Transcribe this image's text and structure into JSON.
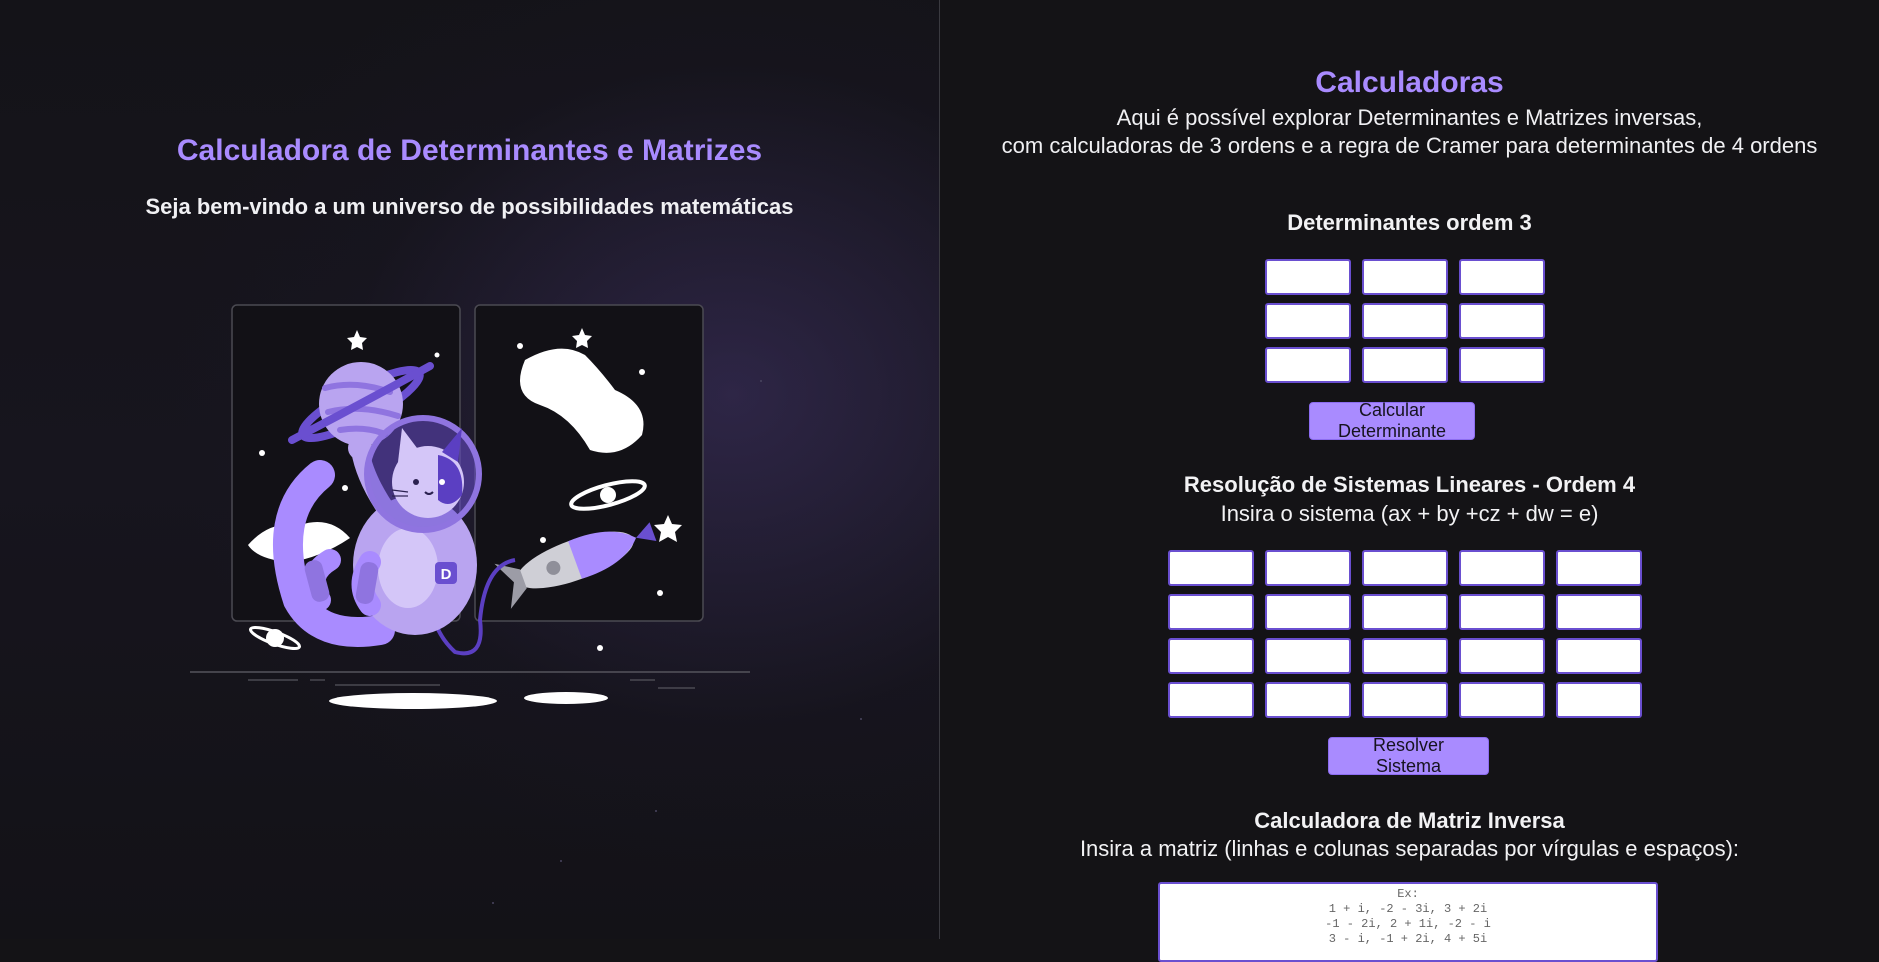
{
  "hero": {
    "title": "Calculadora de Determinantes e Matrizes",
    "subtitle": "Seja bem-vindo a um universo de possibilidades matemáticas",
    "illustration": "astronaut-cat-in-space-illustration"
  },
  "calculators": {
    "title": "Calculadoras",
    "description_line1": "Aqui é possível explorar Determinantes e Matrizes inversas,",
    "description_line2": "com calculadoras de 3 ordens e a regra de Cramer para determinantes de 4 ordens"
  },
  "determinant": {
    "title": "Determinantes ordem 3",
    "rows": 3,
    "cols": 3,
    "button_label": "Calcular Determinante"
  },
  "linear_system": {
    "title": "Resolução de Sistemas Lineares - Ordem 4",
    "subtitle": "Insira o sistema (ax + by +cz + dw = e)",
    "rows": 4,
    "cols": 5,
    "button_label": "Resolver Sistema"
  },
  "inverse": {
    "title": "Calculadora de Matriz Inversa",
    "subtitle": "Insira a matriz (linhas e colunas separadas por vírgulas e espaços):",
    "placeholder": "Ex:\n1 + i, -2 - 3i, 3 + 2i\n-1 - 2i, 2 + 1i, -2 - i\n3 - i, -1 + 2i, 4 + 5i"
  },
  "colors": {
    "accent": "#a98bff",
    "input_border": "#6a4fd0",
    "background": "#141316"
  }
}
